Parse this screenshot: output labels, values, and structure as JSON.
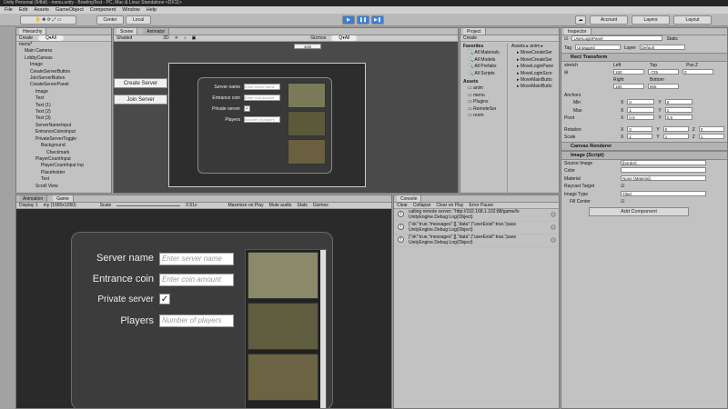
{
  "window": {
    "title": "Unity Personal (64bit) - menu.unity - BowlingTest - PC, Mac & Linux Standalone <DX11>"
  },
  "menu": [
    "File",
    "Edit",
    "Assets",
    "GameObject",
    "Component",
    "Window",
    "Help"
  ],
  "toolbar": {
    "center_label": "Center",
    "local_label": "Local",
    "play_icon": "play-icon",
    "pause_icon": "pause-icon",
    "step_icon": "step-icon",
    "account_label": "Account",
    "layers_label": "Layers",
    "layout_label": "Layout"
  },
  "hierarchy": {
    "tab": "Hierarchy",
    "create_label": "Create",
    "search_placeholder": "Q▾All",
    "items": [
      {
        "label": "menu*",
        "indent": 0,
        "selected": false
      },
      {
        "label": "Main Camera",
        "indent": 1,
        "selected": false
      },
      {
        "label": "LobbyCanvas",
        "indent": 1,
        "selected": false
      },
      {
        "label": "Image",
        "indent": 2,
        "selected": false
      },
      {
        "label": "CreateServerButton",
        "indent": 2,
        "selected": false
      },
      {
        "label": "JoinServerButton",
        "indent": 2,
        "selected": false
      },
      {
        "label": "CreateServerPanel",
        "indent": 2,
        "selected": false
      },
      {
        "label": "Image",
        "indent": 3,
        "selected": false
      },
      {
        "label": "Text",
        "indent": 3,
        "selected": false
      },
      {
        "label": "Text (1)",
        "indent": 3,
        "selected": false
      },
      {
        "label": "Text (2)",
        "indent": 3,
        "selected": false
      },
      {
        "label": "Text (3)",
        "indent": 3,
        "selected": false
      },
      {
        "label": "ServerNameInput",
        "indent": 3,
        "selected": false
      },
      {
        "label": "EntranceCoinsInput",
        "indent": 3,
        "selected": false
      },
      {
        "label": "PrivateServerToggle",
        "indent": 3,
        "selected": false
      },
      {
        "label": "Background",
        "indent": 4,
        "selected": false
      },
      {
        "label": "Checkmark",
        "indent": 5,
        "selected": false
      },
      {
        "label": "PlayerCountInput",
        "indent": 3,
        "selected": false
      },
      {
        "label": "PlayerCountInput Inp",
        "indent": 4,
        "selected": false
      },
      {
        "label": "Placeholder",
        "indent": 4,
        "selected": false
      },
      {
        "label": "Text",
        "indent": 4,
        "selected": false
      },
      {
        "label": "Scroll View",
        "indent": 3,
        "selected": false
      }
    ]
  },
  "scene": {
    "tab_scene": "Scene",
    "tab_animator": "Animator",
    "shading": "Shaded",
    "mode_2d": "2D",
    "gizmos": "Gizmos",
    "search_placeholder": "Q▾All",
    "join_top_label": "Join",
    "create_server_label": "Create Server",
    "join_server_label": "Join Server",
    "form": {
      "server_name": "Server name",
      "server_name_ph": "Enter server name",
      "entrance_coin": "Entrance coin",
      "entrance_coin_ph": "Enter coin amount",
      "private_server": "Private server",
      "players": "Players",
      "players_ph": "Number of players"
    }
  },
  "project": {
    "tab": "Project",
    "create_label": "Create",
    "favorites": "Favorites",
    "fav_items": [
      "All Materials",
      "All Models",
      "All Prefabs",
      "All Scripts"
    ],
    "assets": "Assets",
    "asset_items": [
      "anim",
      "menu",
      "Plugins",
      "RemoteSer",
      "room"
    ],
    "breadcrumb": "Assets ▸ anim ▸",
    "files": [
      "MoveCreateSer",
      "MoveCreateSer",
      "MoveLoginPane",
      "MoveLoginScre",
      "MoveMainButto",
      "MoveMainButto"
    ]
  },
  "inspector": {
    "tab": "Inspector",
    "object_name": "UserLoginPanel",
    "static_label": "Static",
    "tag_label": "Tag",
    "tag_value": "Untagged",
    "layer_label": "Layer",
    "layer_value": "Default",
    "rect_transform": "Rect Transform",
    "stretch": "stretch",
    "left_label": "Left",
    "top_label": "Top",
    "posz_label": "Pos Z",
    "left_value": "180",
    "top_value": "-725",
    "posz_value": "0",
    "right_label": "Right",
    "bottom_label": "Bottom",
    "right_value": "180",
    "bottom_value": "865",
    "anchors_label": "Anchors",
    "min_label": "Min",
    "max_label": "Max",
    "pivot_label": "Pivot",
    "min_x": "0",
    "min_y": "0",
    "max_x": "1",
    "max_y": "1",
    "pivot_x": "0.5",
    "pivot_y": "0.5",
    "rotation_label": "Rotation",
    "rot_x": "0",
    "rot_y": "0",
    "rot_z": "0",
    "scale_label": "Scale",
    "scale_x": "1",
    "scale_y": "1",
    "scale_z": "1",
    "canvas_renderer": "Canvas Renderer",
    "image_script": "Image (Script)",
    "source_image_label": "Source Image",
    "source_image_value": "[border]",
    "color_label": "Color",
    "material_label": "Material",
    "material_value": "None (Material)",
    "raycast_label": "Raycast Target",
    "image_type_label": "Image Type",
    "image_type_value": "Tiled",
    "fill_center_label": "Fill Center",
    "add_component": "Add Component"
  },
  "game": {
    "tab_animation": "Animation",
    "tab_game": "Game",
    "display": "Display 1",
    "resolution": "my (1680x1050)",
    "scale_label": "Scale",
    "scale_value": "0.51x",
    "maximize": "Maximize on Play",
    "mute": "Mute audio",
    "stats": "Stats",
    "gizmos": "Gizmos",
    "form": {
      "server_name": "Server name",
      "server_name_ph": "Enter server name",
      "entrance_coin": "Entrance coin",
      "entrance_coin_ph": "Enter coin amount",
      "private_server": "Private server",
      "players": "Players",
      "players_ph": "Number of players"
    }
  },
  "console": {
    "tab": "Console",
    "clear": "Clear",
    "collapse": "Collapse",
    "clear_on_play": "Clear on Play",
    "error_pause": "Error Pause",
    "lines": [
      {
        "text1": "calling remote server: \"http://192.168.1.102:88/game/lo",
        "text2": "UnityEngine.Debug:Log(Object)",
        "count": "1"
      },
      {
        "text1": "{\"ok\":true,\"messages\":[],\"data\":{\"userExist\":true,\"pass",
        "text2": "UnityEngine.Debug:Log(Object)",
        "count": "1"
      },
      {
        "text1": "{\"ok\":true,\"messages\":[],\"data\":{\"userExist\":true,\"pass",
        "text2": "UnityEngine.Debug:Log(Object)",
        "count": "1"
      }
    ]
  },
  "colors": {
    "selection": "#3d79d6",
    "panel_bg": "#c2c2c2",
    "scene_bg": "#4a4a4a",
    "play_blue": "#3d7fd6"
  }
}
